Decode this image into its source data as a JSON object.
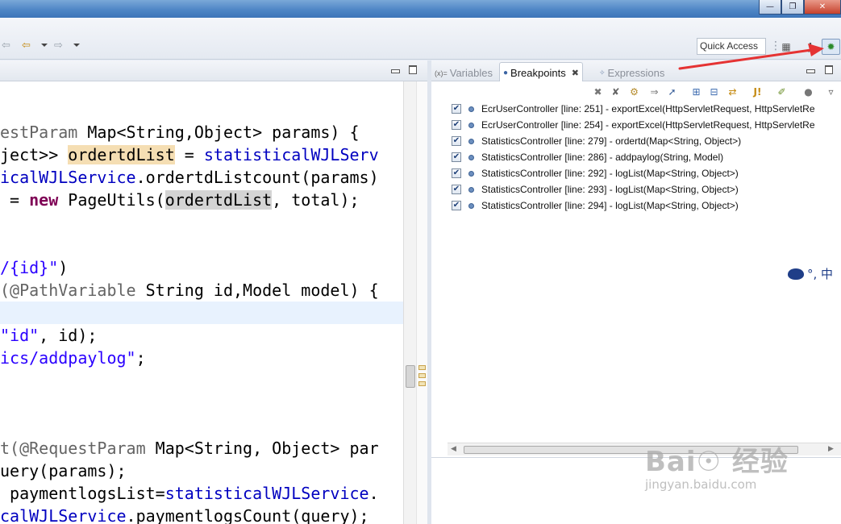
{
  "toolbar": {
    "quick_access_placeholder": "Quick Access",
    "back_icon": "arrow-left-icon",
    "forward_icon": "arrow-right-icon",
    "debug_perspective_icon": "bug-icon"
  },
  "editor": {
    "lines": [
      {
        "segments": [
          {
            "t": "estParam ",
            "c": "ann"
          },
          {
            "t": "Map<String,Object> params) {"
          }
        ]
      },
      {
        "segments": [
          {
            "t": "ject>> "
          },
          {
            "t": "ordertdList",
            "c": "occ"
          },
          {
            "t": " = "
          },
          {
            "t": "statisticalWJLServ",
            "c": "fld"
          }
        ]
      },
      {
        "segments": [
          {
            "t": "icalWJLService",
            "c": "fld"
          },
          {
            "t": ".ordertdListcount(params)"
          }
        ]
      },
      {
        "segments": [
          {
            "t": " = "
          },
          {
            "t": "new",
            "c": "kw"
          },
          {
            "t": " PageUtils("
          },
          {
            "t": "ordertdList",
            "c": "occ2"
          },
          {
            "t": ", total);"
          }
        ]
      },
      {
        "segments": []
      },
      {
        "segments": []
      },
      {
        "segments": [
          {
            "t": "/{id}\"",
            "c": "str"
          },
          {
            "t": ")"
          }
        ]
      },
      {
        "segments": [
          {
            "t": "(@PathVariable",
            "c": "ann"
          },
          {
            "t": " String id,Model model) {"
          }
        ]
      },
      {
        "segments": []
      },
      {
        "segments": [
          {
            "t": "\"id\"",
            "c": "str"
          },
          {
            "t": ", id);"
          }
        ]
      },
      {
        "segments": [
          {
            "t": "ics/addpaylog\"",
            "c": "str"
          },
          {
            "t": ";"
          }
        ]
      },
      {
        "segments": []
      },
      {
        "segments": []
      },
      {
        "segments": []
      },
      {
        "segments": [
          {
            "t": "t(@RequestParam",
            "c": "ann"
          },
          {
            "t": " Map<String, Object> par"
          }
        ]
      },
      {
        "segments": [
          {
            "t": "uery(params);"
          }
        ]
      },
      {
        "segments": [
          {
            "t": " paymentlogsList="
          },
          {
            "t": "statisticalWJLService",
            "c": "fld"
          },
          {
            "t": "."
          }
        ]
      },
      {
        "segments": [
          {
            "t": "calWJLService",
            "c": "fld"
          },
          {
            "t": ".paymentlogsCount(query);"
          }
        ]
      }
    ]
  },
  "views": {
    "tabs": [
      {
        "label": "Variables",
        "icon": "(x)=",
        "active": false
      },
      {
        "label": "Breakpoints",
        "icon": "breakpoint-icon",
        "active": true,
        "close": "✖"
      },
      {
        "label": "Expressions",
        "icon": "expressions-icon",
        "active": false
      }
    ]
  },
  "breakpoints": [
    {
      "label": "EcrUserController [line: 251] - exportExcel(HttpServletRequest, HttpServletRe",
      "checked": true
    },
    {
      "label": "EcrUserController [line: 254] - exportExcel(HttpServletRequest, HttpServletRe",
      "checked": true
    },
    {
      "label": "StatisticsController [line: 279] - ordertd(Map<String, Object>)",
      "checked": true
    },
    {
      "label": "StatisticsController [line: 286] - addpaylog(String, Model)",
      "checked": true
    },
    {
      "label": "StatisticsController [line: 292] - logList(Map<String, Object>)",
      "checked": true
    },
    {
      "label": "StatisticsController [line: 293] - logList(Map<String, Object>)",
      "checked": true
    },
    {
      "label": "StatisticsController [line: 294] - logList(Map<String, Object>)",
      "checked": true
    }
  ],
  "ime": {
    "text": "°, 中"
  },
  "watermark": {
    "brand": "Bai☉ 经验",
    "url": "jingyan.baidu.com"
  },
  "colors": {
    "annotation_arrow": "#e53333",
    "accent": "#4f86c6"
  }
}
